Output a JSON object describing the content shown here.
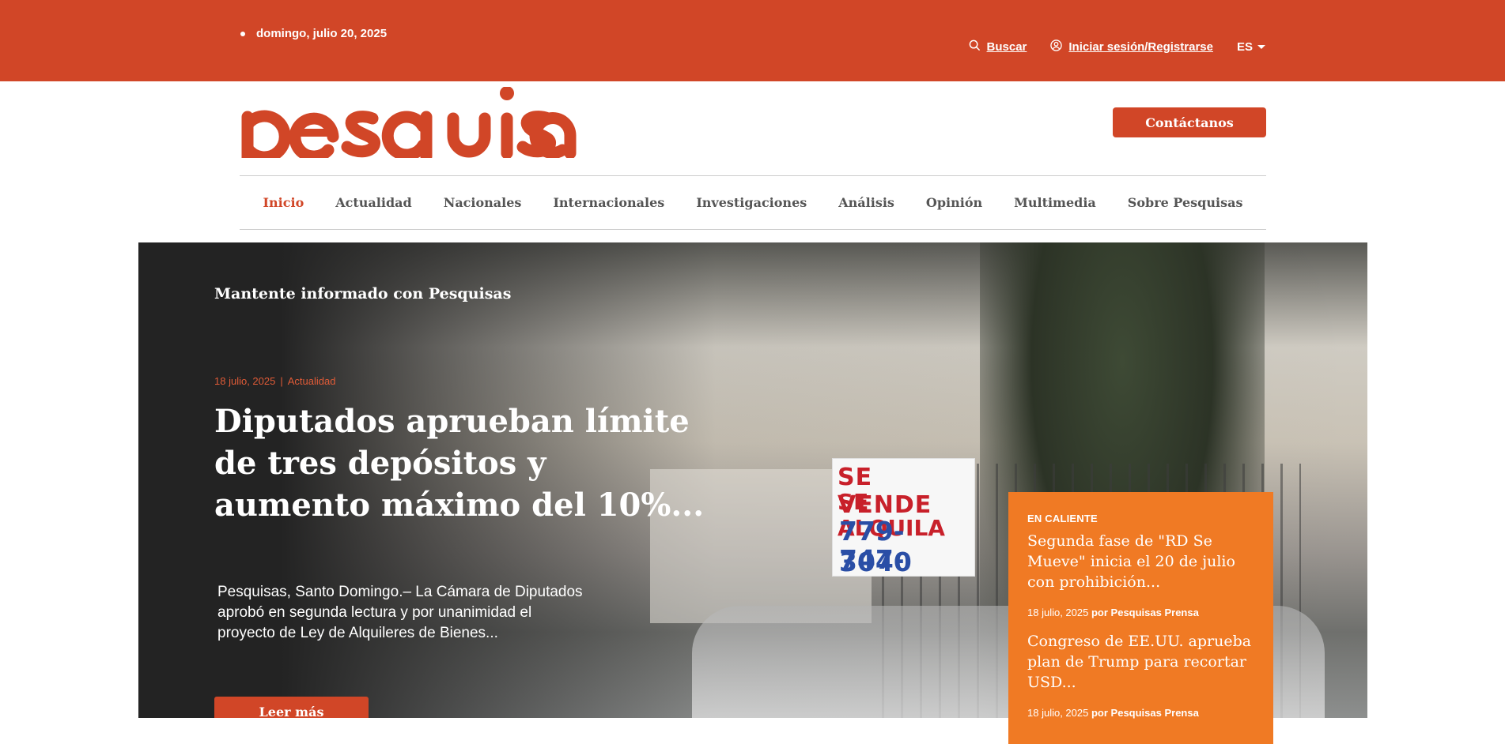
{
  "topbar": {
    "date": "domingo, julio 20, 2025",
    "search_label": "Buscar",
    "login_label": "Iniciar sesión/Registrarse",
    "language": "ES"
  },
  "header": {
    "logo_text": "pesquisas",
    "contact_label": "Contáctanos"
  },
  "nav": {
    "items": [
      {
        "label": "Inicio"
      },
      {
        "label": "Actualidad"
      },
      {
        "label": "Nacionales"
      },
      {
        "label": "Internacionales"
      },
      {
        "label": "Investigaciones"
      },
      {
        "label": "Análisis"
      },
      {
        "label": "Opinión"
      },
      {
        "label": "Multimedia"
      },
      {
        "label": "Sobre Pesquisas"
      }
    ],
    "active": "Inicio"
  },
  "hero": {
    "kicker": "Mantente informado con Pesquisas",
    "date": "18 julio, 2025",
    "separator": "|",
    "category": "Actualidad",
    "title": "Diputados aprueban límite de tres depósitos y aumento máximo del 10%...",
    "excerpt": "Pesquisas, Santo Domingo.– La Cámara de Diputados aprobó en segunda lectura y por unanimidad el proyecto de Ley de Alquileres de Bienes...",
    "read_more_label": "Leer más",
    "photo_sign": {
      "line1": "SE VENDE",
      "line2": "SE ALQUILA",
      "line3": "779-3040",
      "line4": "747-9013"
    }
  },
  "hot": {
    "label": "EN CALIENTE",
    "items": [
      {
        "title": "Segunda fase de \"RD Se Mueve\" inicia el 20 de julio con prohibición...",
        "date": "18 julio, 2025",
        "by": "por",
        "author": "Pesquisas Prensa"
      },
      {
        "title": "Congreso de EE.UU. aprueba plan de Trump para recortar USD...",
        "date": "18 julio, 2025",
        "by": "por",
        "author": "Pesquisas Prensa"
      }
    ]
  },
  "colors": {
    "brand": "#d14627",
    "hot_panel": "#f07a24",
    "hero_bg": "#232323"
  }
}
